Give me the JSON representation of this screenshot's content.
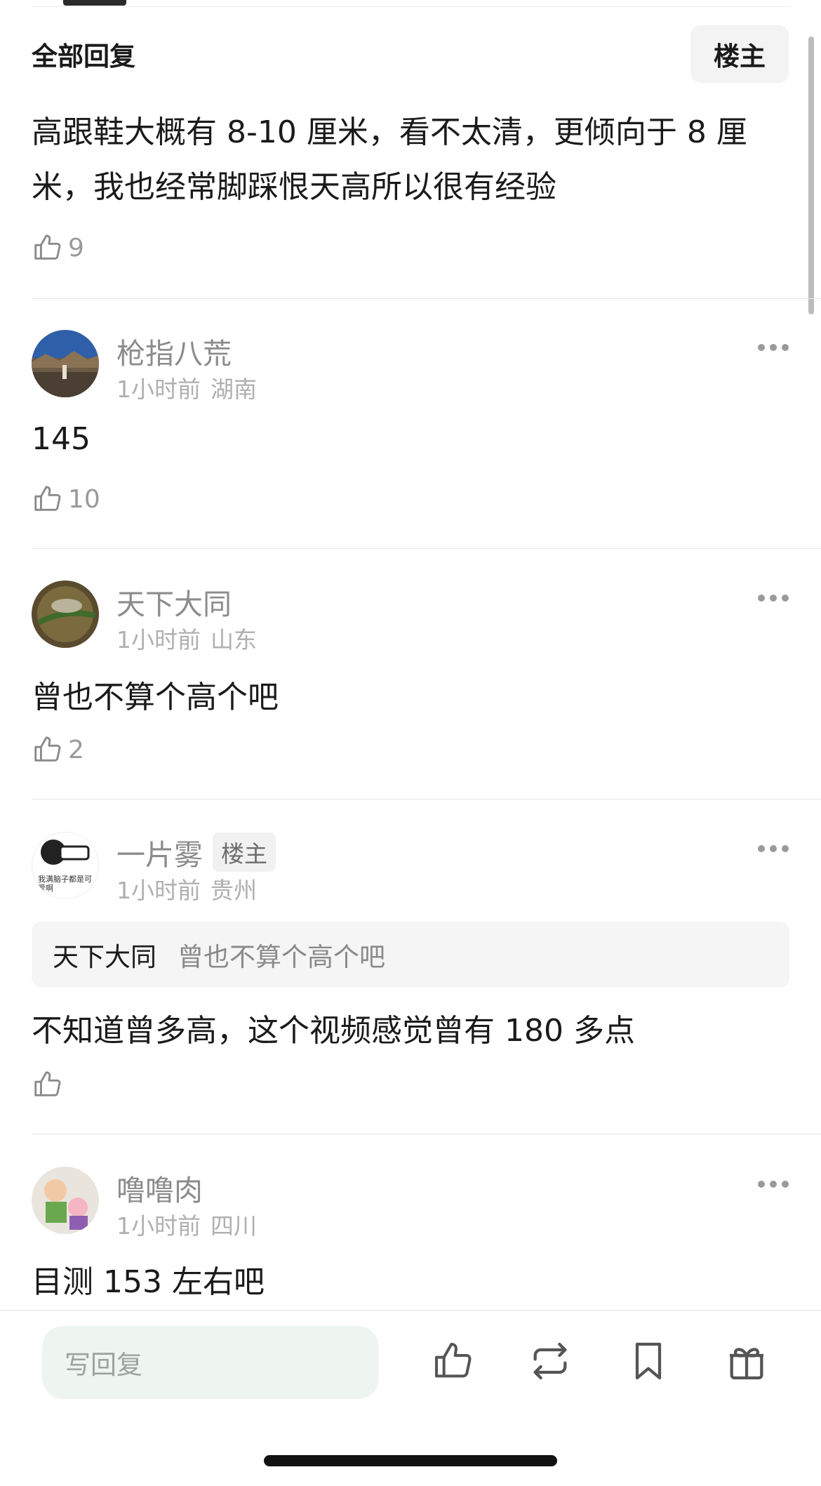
{
  "header": {
    "title": "全部回复",
    "op_button": "楼主"
  },
  "op_reply": {
    "text": "高跟鞋大概有 8-10 厘米，看不太清，更倾向于 8 厘米，我也经常脚踩恨天高所以很有经验",
    "likes": "9"
  },
  "comments": [
    {
      "username": "枪指八荒",
      "time": "1小时前",
      "location": "湖南",
      "text": "145",
      "likes": "10"
    },
    {
      "username": "天下大同",
      "time": "1小时前",
      "location": "山东",
      "text": "曾也不算个高个吧",
      "likes": "2"
    },
    {
      "username": "一片雾",
      "badge": "楼主",
      "time": "1小时前",
      "location": "贵州",
      "avatar_text_1": "我满脑子都是可",
      "avatar_text_2": "爱啊",
      "quote": {
        "name": "天下大同",
        "text": "曾也不算个高个吧"
      },
      "text": "不知道曾多高，这个视频感觉曾有 180 多点",
      "likes": ""
    },
    {
      "username": "噜噜肉",
      "time": "1小时前",
      "location": "四川",
      "text": "目测 153 左右吧"
    }
  ],
  "bottom_bar": {
    "reply_placeholder": "写回复",
    "icons": [
      "like-icon",
      "repost-icon",
      "bookmark-icon",
      "gift-icon"
    ]
  }
}
